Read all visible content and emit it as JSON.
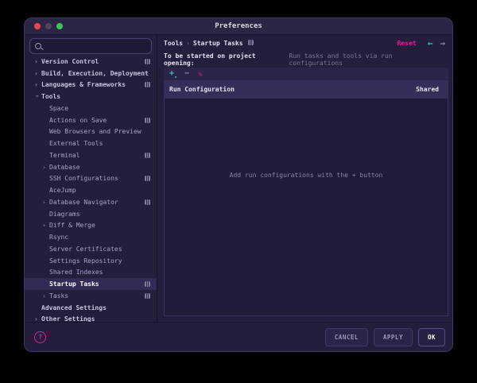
{
  "window": {
    "title": "Preferences"
  },
  "colors": {
    "accent_magenta": "#e3189b",
    "accent_teal": "#2ec8b4",
    "window_bg": "#241e3c",
    "selection_bg": "#332b55",
    "traffic_red": "#e5484d",
    "traffic_green": "#32c956"
  },
  "sidebar": {
    "search": {
      "placeholder": "",
      "value": ""
    },
    "items": [
      {
        "label": "Version Control",
        "level": 0,
        "chevron": "right",
        "badge": true,
        "selected": false
      },
      {
        "label": "Build, Execution, Deployment",
        "level": 0,
        "chevron": "right",
        "badge": false,
        "selected": false
      },
      {
        "label": "Languages & Frameworks",
        "level": 0,
        "chevron": "right",
        "badge": true,
        "selected": false
      },
      {
        "label": "Tools",
        "level": 0,
        "chevron": "down",
        "badge": false,
        "selected": false
      },
      {
        "label": "Space",
        "level": 1,
        "chevron": null,
        "badge": false,
        "selected": false
      },
      {
        "label": "Actions on Save",
        "level": 1,
        "chevron": null,
        "badge": true,
        "selected": false
      },
      {
        "label": "Web Browsers and Preview",
        "level": 1,
        "chevron": null,
        "badge": false,
        "selected": false
      },
      {
        "label": "External Tools",
        "level": 1,
        "chevron": null,
        "badge": false,
        "selected": false
      },
      {
        "label": "Terminal",
        "level": 1,
        "chevron": null,
        "badge": true,
        "selected": false
      },
      {
        "label": "Database",
        "level": 1,
        "chevron": "right",
        "badge": false,
        "selected": false
      },
      {
        "label": "SSH Configurations",
        "level": 1,
        "chevron": null,
        "badge": true,
        "selected": false
      },
      {
        "label": "AceJump",
        "level": 1,
        "chevron": null,
        "badge": false,
        "selected": false
      },
      {
        "label": "Database Navigator",
        "level": 1,
        "chevron": "right",
        "badge": true,
        "selected": false
      },
      {
        "label": "Diagrams",
        "level": 1,
        "chevron": null,
        "badge": false,
        "selected": false
      },
      {
        "label": "Diff & Merge",
        "level": 1,
        "chevron": "right",
        "badge": false,
        "selected": false
      },
      {
        "label": "Rsync",
        "level": 1,
        "chevron": null,
        "badge": false,
        "selected": false
      },
      {
        "label": "Server Certificates",
        "level": 1,
        "chevron": null,
        "badge": false,
        "selected": false
      },
      {
        "label": "Settings Repository",
        "level": 1,
        "chevron": null,
        "badge": false,
        "selected": false
      },
      {
        "label": "Shared Indexes",
        "level": 1,
        "chevron": null,
        "badge": false,
        "selected": false
      },
      {
        "label": "Startup Tasks",
        "level": 1,
        "chevron": null,
        "badge": true,
        "selected": true
      },
      {
        "label": "Tasks",
        "level": 1,
        "chevron": "right",
        "badge": true,
        "selected": false
      },
      {
        "label": "Advanced Settings",
        "level": 0,
        "chevron": null,
        "badge": false,
        "selected": false
      },
      {
        "label": "Other Settings",
        "level": 0,
        "chevron": "right",
        "badge": false,
        "selected": false
      }
    ]
  },
  "content": {
    "breadcrumb": {
      "parts": [
        "Tools",
        "Startup Tasks"
      ],
      "separator": "›"
    },
    "reset_label": "Reset",
    "back_arrow": "←",
    "forward_arrow": "→",
    "opening_label": "To be started on project opening:",
    "hint": "Run tasks and tools via run configurations",
    "toolbar": {
      "add": "+",
      "remove": "−",
      "edit": "✎"
    },
    "table": {
      "columns": [
        "Run Configuration",
        "Shared"
      ],
      "empty_text": "Add run configurations with the + button"
    }
  },
  "footer": {
    "help": "?",
    "buttons": [
      {
        "label": "CANCEL",
        "name": "cancel-button",
        "primary": false
      },
      {
        "label": "APPLY",
        "name": "apply-button",
        "primary": false
      },
      {
        "label": "OK",
        "name": "ok-button",
        "primary": true
      }
    ]
  }
}
